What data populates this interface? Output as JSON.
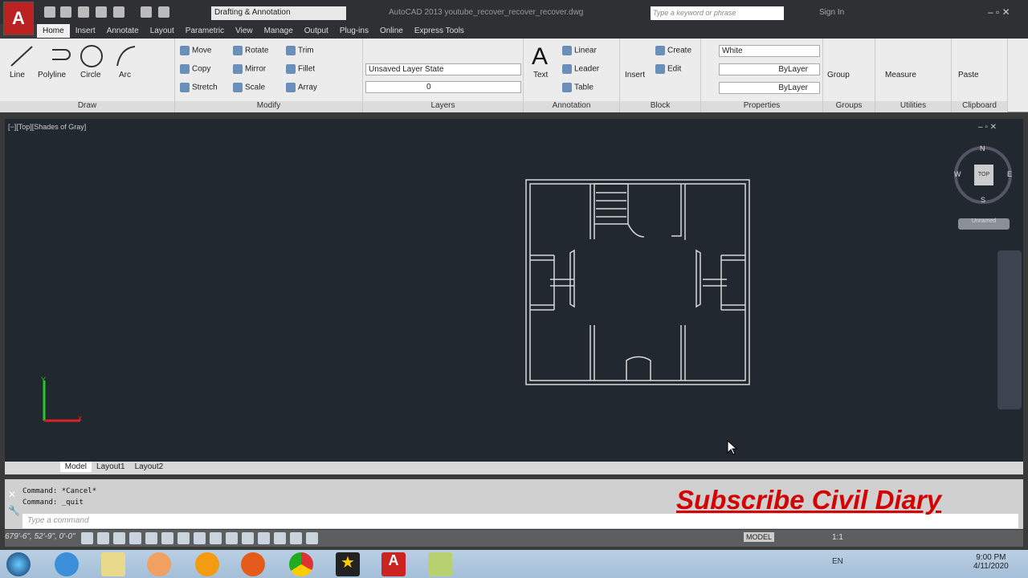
{
  "titlebar": {
    "workspace": "Drafting & Annotation",
    "title": "AutoCAD 2013   youtube_recover_recover_recover.dwg",
    "search_placeholder": "Type a keyword or phrase",
    "sign_in": "Sign In"
  },
  "tabs": [
    "Home",
    "Insert",
    "Annotate",
    "Layout",
    "Parametric",
    "View",
    "Manage",
    "Output",
    "Plug-ins",
    "Online",
    "Express Tools"
  ],
  "ribbon": {
    "draw": {
      "label": "Draw",
      "line": "Line",
      "polyline": "Polyline",
      "circle": "Circle",
      "arc": "Arc"
    },
    "modify": {
      "label": "Modify",
      "move": "Move",
      "rotate": "Rotate",
      "trim": "Trim",
      "copy": "Copy",
      "mirror": "Mirror",
      "fillet": "Fillet",
      "stretch": "Stretch",
      "scale": "Scale",
      "array": "Array"
    },
    "layers": {
      "label": "Layers",
      "layer_state": "Unsaved Layer State",
      "layer": "0"
    },
    "annotation": {
      "label": "Annotation",
      "text": "Text",
      "linear": "Linear",
      "leader": "Leader",
      "table": "Table"
    },
    "block": {
      "label": "Block",
      "insert": "Insert",
      "create": "Create",
      "edit": "Edit"
    },
    "properties": {
      "label": "Properties",
      "color": "White",
      "linetype": "ByLayer",
      "lineweight": "ByLayer"
    },
    "groups": {
      "label": "Groups",
      "group": "Group"
    },
    "utilities": {
      "label": "Utilities",
      "measure": "Measure"
    },
    "clipboard": {
      "label": "Clipboard",
      "paste": "Paste"
    }
  },
  "viewport": {
    "label": "[−][Top][Shades of Gray]",
    "compass": {
      "n": "N",
      "s": "S",
      "e": "E",
      "w": "W",
      "top": "TOP"
    },
    "ucs": "Unnamed"
  },
  "layout_tabs": [
    "Model",
    "Layout1",
    "Layout2"
  ],
  "command": {
    "history": [
      "Command: *Cancel*",
      "Command: _quit"
    ],
    "placeholder": "Type a command"
  },
  "status": {
    "coords": "679'-6\", 52'-9\", 0'-0\"",
    "model": "MODEL",
    "scale": "1:1"
  },
  "taskbar": {
    "lang": "EN",
    "time": "9:00 PM",
    "date": "4/11/2020"
  },
  "overlay": {
    "promo": "Subscribe Civil Diary"
  }
}
